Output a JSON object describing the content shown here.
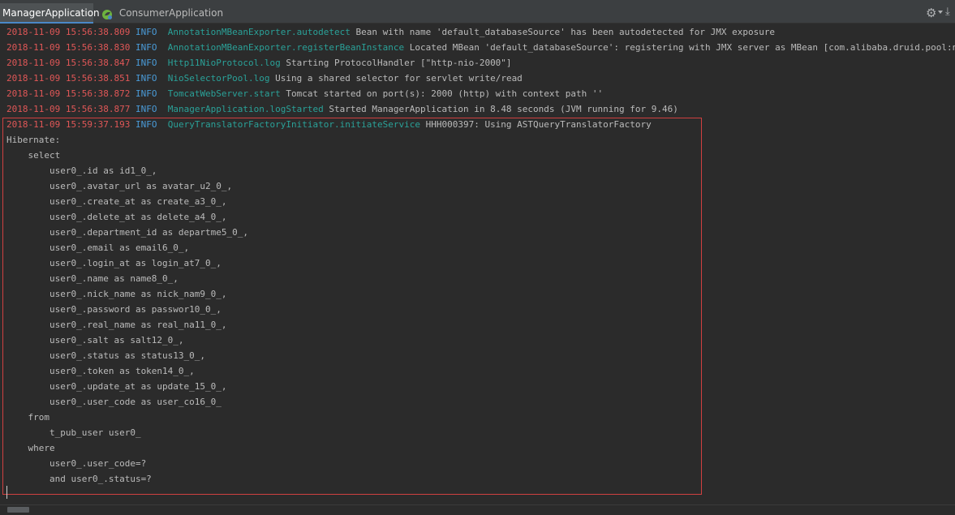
{
  "tabs": [
    {
      "label": "ManagerApplication",
      "active": true
    },
    {
      "label": "ConsumerApplication",
      "active": false
    }
  ],
  "toolbar": {
    "settings_icon": "gear-icon",
    "download_icon": "download-icon"
  },
  "colors": {
    "timestamp": "#e05757",
    "level": "#4a9bd8",
    "source": "#2aa198",
    "highlight_border": "#d04040"
  },
  "log": [
    {
      "ts": "2018-11-09 15:56:38.809",
      "level": "INFO",
      "source": "AnnotationMBeanExporter.autodetect",
      "message": "Bean with name 'default_databaseSource' has been autodetected for JMX exposure"
    },
    {
      "ts": "2018-11-09 15:56:38.830",
      "level": "INFO",
      "source": "AnnotationMBeanExporter.registerBeanInstance",
      "message": "Located MBean 'default_databaseSource': registering with JMX server as MBean [com.alibaba.druid.pool:name=default_databa"
    },
    {
      "ts": "2018-11-09 15:56:38.847",
      "level": "INFO",
      "source": "Http11NioProtocol.log",
      "message": "Starting ProtocolHandler [\"http-nio-2000\"]"
    },
    {
      "ts": "2018-11-09 15:56:38.851",
      "level": "INFO",
      "source": "NioSelectorPool.log",
      "message": "Using a shared selector for servlet write/read"
    },
    {
      "ts": "2018-11-09 15:56:38.872",
      "level": "INFO",
      "source": "TomcatWebServer.start",
      "message": "Tomcat started on port(s): 2000 (http) with context path ''"
    },
    {
      "ts": "2018-11-09 15:56:38.877",
      "level": "INFO",
      "source": "ManagerApplication.logStarted",
      "message": "Started ManagerApplication in 8.48 seconds (JVM running for 9.46)"
    },
    {
      "ts": "2018-11-09 15:59:37.193",
      "level": "INFO",
      "source": "QueryTranslatorFactoryInitiator.initiateService",
      "message": "HHH000397: Using ASTQueryTranslatorFactory"
    }
  ],
  "sql": [
    "Hibernate:",
    "    select",
    "        user0_.id as id1_0_,",
    "        user0_.avatar_url as avatar_u2_0_,",
    "        user0_.create_at as create_a3_0_,",
    "        user0_.delete_at as delete_a4_0_,",
    "        user0_.department_id as departme5_0_,",
    "        user0_.email as email6_0_,",
    "        user0_.login_at as login_at7_0_,",
    "        user0_.name as name8_0_,",
    "        user0_.nick_name as nick_nam9_0_,",
    "        user0_.password as passwor10_0_,",
    "        user0_.real_name as real_na11_0_,",
    "        user0_.salt as salt12_0_,",
    "        user0_.status as status13_0_,",
    "        user0_.token as token14_0_,",
    "        user0_.update_at as update_15_0_,",
    "        user0_.user_code as user_co16_0_",
    "    from",
    "        t_pub_user user0_",
    "    where",
    "        user0_.user_code=?",
    "        and user0_.status=?"
  ]
}
